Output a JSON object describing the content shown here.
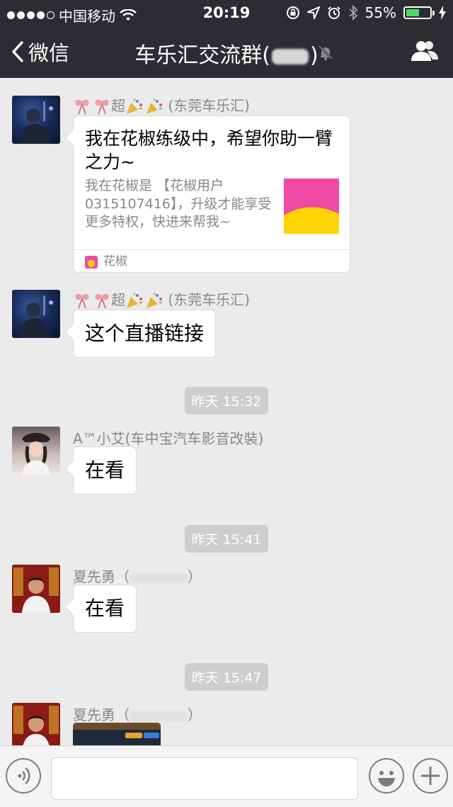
{
  "status_bar": {
    "carrier": "中国移动",
    "time": "20:19",
    "battery_percent": "55%",
    "battery_level": 0.55
  },
  "nav": {
    "back_label": "微信",
    "title_prefix": "车乐汇交流群(",
    "title_suffix": ")"
  },
  "messages": [
    {
      "sender_name": "超",
      "sender_group": "(东莞车乐汇)",
      "card": {
        "title": "我在花椒练级中，希望你助一臂之力~",
        "description": "我在花椒是 【花椒用户0315107416】，升级才能享受更多特权，快进来帮我~",
        "source": "花椒"
      }
    },
    {
      "sender_name": "超",
      "sender_group": "(东莞车乐汇)",
      "text": "这个直播链接"
    },
    {
      "timestamp": "昨天 15:32"
    },
    {
      "sender_name": "A™小艾(车中宝汽车影音改裝)",
      "text": "在看"
    },
    {
      "timestamp": "昨天 15:41"
    },
    {
      "sender_name": "夏先勇（",
      "sender_suffix": "）",
      "text": "在看"
    },
    {
      "timestamp": "昨天 15:47"
    },
    {
      "sender_name": "夏先勇（",
      "sender_suffix": "）"
    }
  ],
  "colors": {
    "nav_bg": "#2c2c31",
    "chat_bg": "#ebebeb",
    "bubble_bg": "#ffffff",
    "timestamp_bg": "#cecece",
    "battery_fill": "#4cd964"
  },
  "icons": {
    "signal": "signal-dots-icon",
    "wifi": "wifi-icon",
    "lock_rotation": "rotation-lock-icon",
    "location": "location-arrow-icon",
    "alarm": "alarm-icon",
    "bluetooth": "bluetooth-icon",
    "charging": "charging-bolt-icon",
    "back": "chevron-left-icon",
    "mute": "muted-bell-icon",
    "group_members": "group-members-icon",
    "voice": "voice-input-icon",
    "emoji": "emoji-icon",
    "more": "plus-icon"
  }
}
